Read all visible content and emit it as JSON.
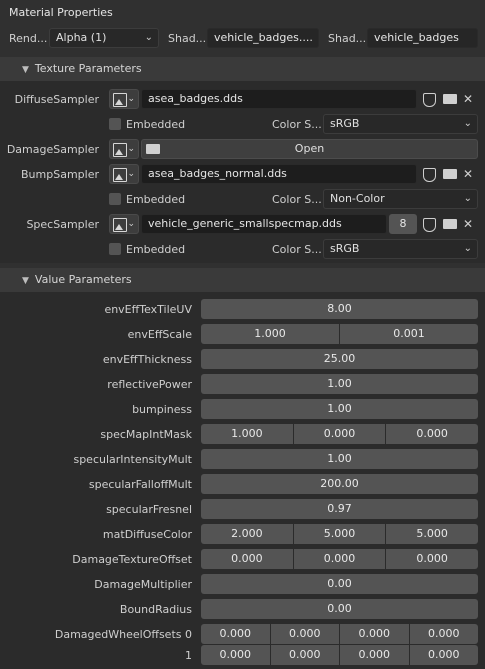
{
  "title": "Material Properties",
  "top": {
    "render_label": "Rend...",
    "render_value": "Alpha (1)",
    "shader_label1": "Shad...",
    "shader_value1": "vehicle_badges....",
    "shader_label2": "Shad...",
    "shader_value2": "vehicle_badges"
  },
  "texture_panel": {
    "header": "Texture Parameters",
    "diffuse": {
      "label": "DiffuseSampler",
      "file": "asea_badges.dds",
      "embedded": "Embedded",
      "color_label": "Color S...",
      "color_value": "sRGB"
    },
    "damage": {
      "label": "DamageSampler",
      "open": "Open"
    },
    "bump": {
      "label": "BumpSampler",
      "file": "asea_badges_normal.dds",
      "embedded": "Embedded",
      "color_label": "Color S...",
      "color_value": "Non-Color"
    },
    "spec": {
      "label": "SpecSampler",
      "file": "vehicle_generic_smallspecmap.dds",
      "users": "8",
      "embedded": "Embedded",
      "color_label": "Color S...",
      "color_value": "sRGB"
    }
  },
  "value_panel": {
    "header": "Value Parameters",
    "rows": [
      {
        "label": "envEffTexTileUV",
        "values": [
          "8.00"
        ]
      },
      {
        "label": "envEffScale",
        "values": [
          "1.000",
          "0.001"
        ]
      },
      {
        "label": "envEffThickness",
        "values": [
          "25.00"
        ]
      },
      {
        "label": "reflectivePower",
        "values": [
          "1.00"
        ]
      },
      {
        "label": "bumpiness",
        "values": [
          "1.00"
        ]
      },
      {
        "label": "specMapIntMask",
        "values": [
          "1.000",
          "0.000",
          "0.000"
        ]
      },
      {
        "label": "specularIntensityMult",
        "values": [
          "1.00"
        ]
      },
      {
        "label": "specularFalloffMult",
        "values": [
          "200.00"
        ]
      },
      {
        "label": "specularFresnel",
        "values": [
          "0.97"
        ]
      },
      {
        "label": "matDiffuseColor",
        "values": [
          "2.000",
          "5.000",
          "5.000"
        ]
      },
      {
        "label": "DamageTextureOffset",
        "values": [
          "0.000",
          "0.000",
          "0.000"
        ]
      },
      {
        "label": "DamageMultiplier",
        "values": [
          "0.00"
        ]
      },
      {
        "label": "BoundRadius",
        "values": [
          "0.00"
        ]
      },
      {
        "label": "DamagedWheelOffsets 0",
        "values": [
          "0.000",
          "0.000",
          "0.000",
          "0.000"
        ]
      },
      {
        "label": "1",
        "values": [
          "0.000",
          "0.000",
          "0.000",
          "0.000"
        ]
      }
    ]
  }
}
